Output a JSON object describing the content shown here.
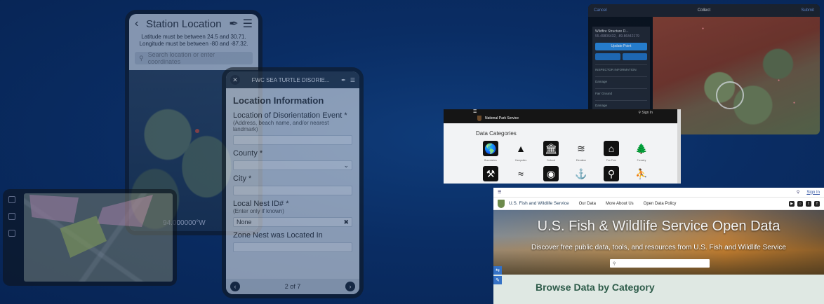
{
  "station": {
    "title": "Station Location",
    "note": "Latitude must be between 24.5 and 30.71. Longitude must be between -80 and -87.32.",
    "search_placeholder": "Search location or enter coordinates",
    "coordinate": "94.000000°W"
  },
  "fwc_form": {
    "title": "FWC SEA TURTLE DISORIE...",
    "section": "Location Information",
    "fields": [
      {
        "label": "Location of Disorientation Event *",
        "hint": "(Address, beach name, and/or nearest landmark)",
        "value": ""
      },
      {
        "label": "County *",
        "hint": "",
        "value": ""
      },
      {
        "label": "City *",
        "hint": "",
        "value": ""
      },
      {
        "label": "Local Nest ID# *",
        "hint": "(Enter only if known)",
        "value": "None"
      },
      {
        "label": "Zone Nest was Located In",
        "hint": "",
        "value": ""
      }
    ],
    "pager": "2 of 7"
  },
  "collect": {
    "left": "Cancel",
    "center": "Collect",
    "right": "Submit",
    "card_title": "Wildfire Structure D...",
    "card_sub": "55.49806432, -89.86442179",
    "update_button": "Update Point",
    "rows": [
      "INSPECTOR INFORMATION",
      "Damage",
      "Fair Ground",
      "Damage",
      "Superficial Damage (1-9%)",
      "STRUCTURE INFORMATION"
    ]
  },
  "nps": {
    "brand": "National Park Service",
    "search": "Sign In",
    "heading": "Data Categories",
    "categories": [
      "Boundaries",
      "Campsites",
      "Cultural",
      "Elevation",
      "Fee Free",
      "Forestry",
      "Geology",
      "Hydrography",
      "Location",
      "Marine",
      "Natural",
      "Recreation"
    ]
  },
  "fws": {
    "sign_in": "Sign In",
    "brand": "U.S. Fish and Wildlife Service",
    "nav": [
      "Our Data",
      "More About Us",
      "Open Data Policy"
    ],
    "hero_title": "U.S. Fish & Wildlife Service Open Data",
    "hero_subtitle": "Discover free public data, tools, and resources from U.S. Fish and Wildlife Service",
    "search_placeholder": "",
    "browse_heading": "Browse Data by Category"
  }
}
